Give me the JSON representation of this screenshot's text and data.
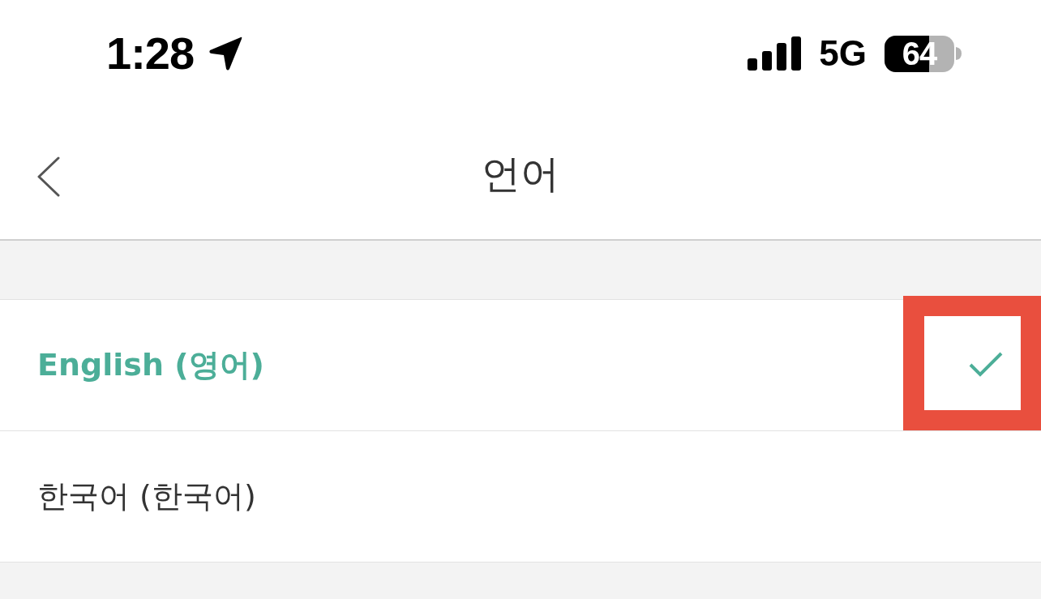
{
  "status_bar": {
    "time": "1:28",
    "network": "5G",
    "battery": "64"
  },
  "nav": {
    "title": "언어"
  },
  "languages": [
    {
      "label": "English (영어)",
      "selected": true
    },
    {
      "label": "한국어 (한국어)",
      "selected": false
    }
  ]
}
